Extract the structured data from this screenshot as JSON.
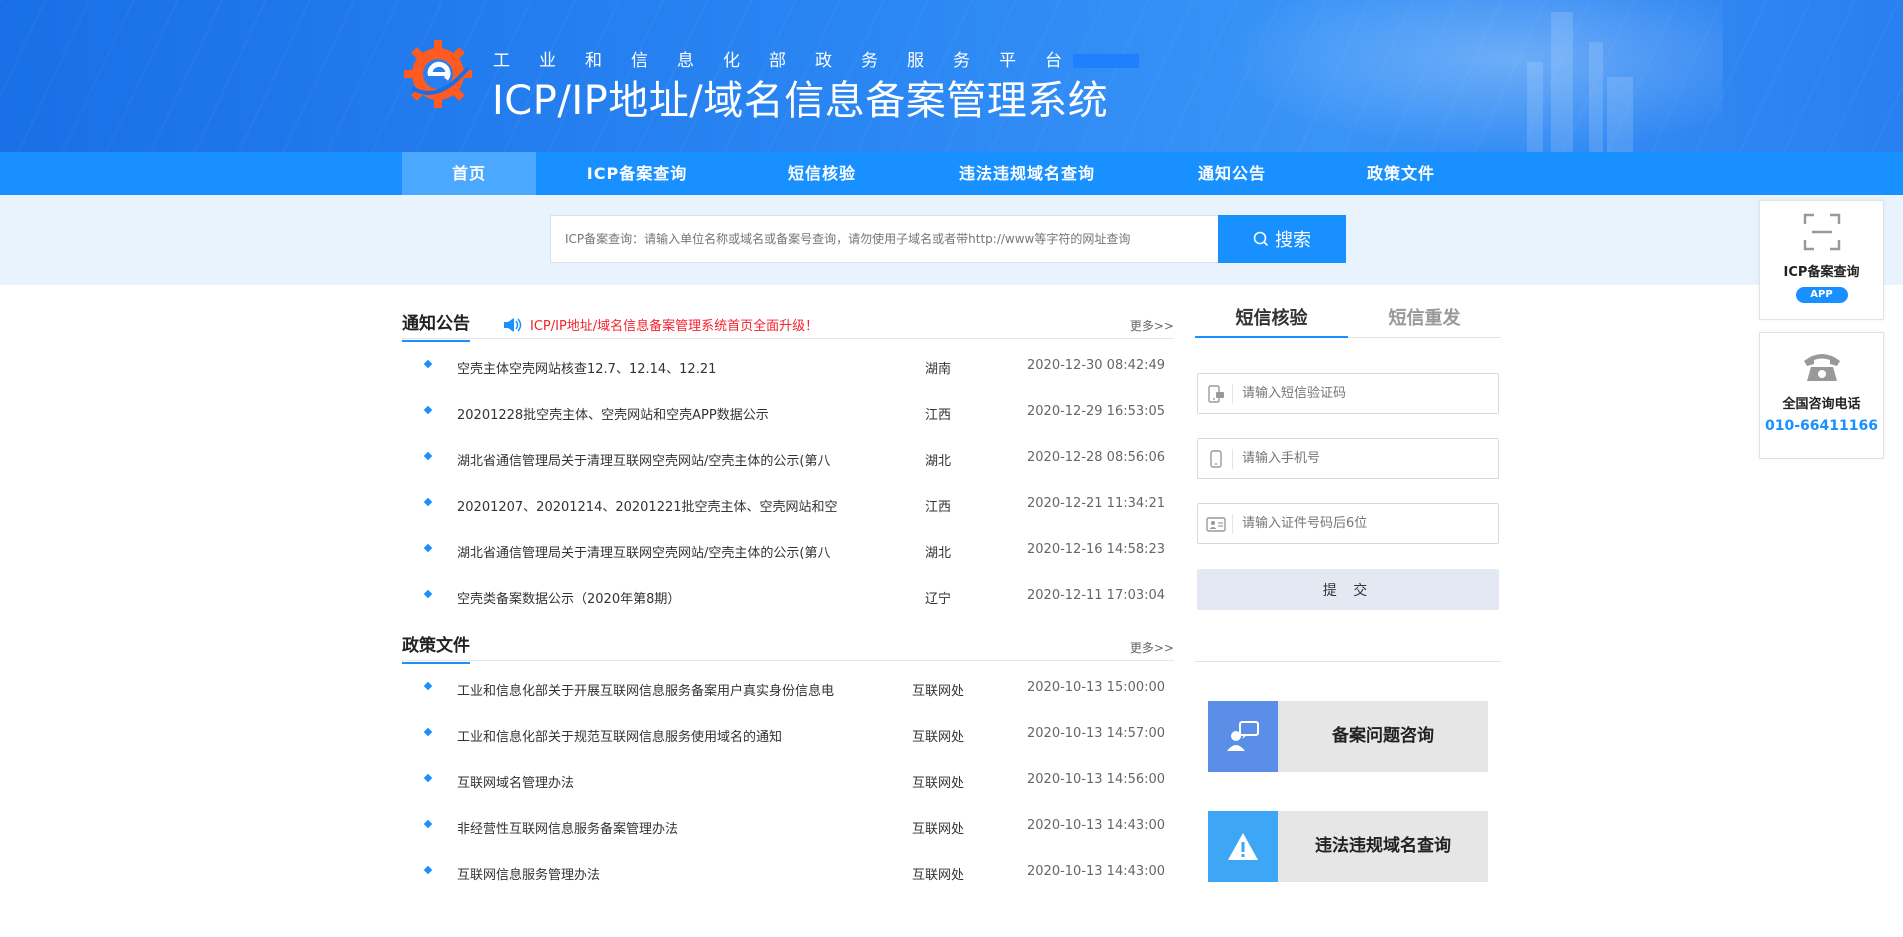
{
  "header": {
    "subtitle": "工业和信息化部政务服务平台",
    "title": "ICP/IP地址/域名信息备案管理系统"
  },
  "nav": {
    "items": [
      {
        "label": "首页",
        "active": true
      },
      {
        "label": "ICP备案查询"
      },
      {
        "label": "短信核验"
      },
      {
        "label": "违法违规域名查询"
      },
      {
        "label": "通知公告"
      },
      {
        "label": "政策文件"
      }
    ]
  },
  "search": {
    "placeholder": "ICP备案查询：请输入单位名称或域名或备案号查询，请勿使用子域名或者带http://www等字符的网址查询",
    "button_label": "搜索"
  },
  "notices": {
    "title": "通知公告",
    "alert": "ICP/IP地址/域名信息备案管理系统首页全面升级！",
    "more": "更多>>",
    "items": [
      {
        "title": "空壳主体空壳网站核查12.7、12.14、12.21",
        "region": "湖南",
        "date": "2020-12-30 08:42:49"
      },
      {
        "title": "20201228批空壳主体、空壳网站和空壳APP数据公示",
        "region": "江西",
        "date": "2020-12-29 16:53:05"
      },
      {
        "title": "湖北省通信管理局关于清理互联网空壳网站/空壳主体的公示(第八",
        "region": "湖北",
        "date": "2020-12-28 08:56:06"
      },
      {
        "title": "20201207、20201214、20201221批空壳主体、空壳网站和空",
        "region": "江西",
        "date": "2020-12-21 11:34:21"
      },
      {
        "title": "湖北省通信管理局关于清理互联网空壳网站/空壳主体的公示(第八",
        "region": "湖北",
        "date": "2020-12-16 14:58:23"
      },
      {
        "title": "空壳类备案数据公示（2020年第8期）",
        "region": "辽宁",
        "date": "2020-12-11 17:03:04"
      }
    ]
  },
  "policies": {
    "title": "政策文件",
    "more": "更多>>",
    "items": [
      {
        "title": "工业和信息化部关于开展互联网信息服务备案用户真实身份信息电",
        "region": "互联网处",
        "date": "2020-10-13 15:00:00"
      },
      {
        "title": "工业和信息化部关于规范互联网信息服务使用域名的通知",
        "region": "互联网处",
        "date": "2020-10-13 14:57:00"
      },
      {
        "title": "互联网域名管理办法",
        "region": "互联网处",
        "date": "2020-10-13 14:56:00"
      },
      {
        "title": "非经营性互联网信息服务备案管理办法",
        "region": "互联网处",
        "date": "2020-10-13 14:43:00"
      },
      {
        "title": "互联网信息服务管理办法",
        "region": "互联网处",
        "date": "2020-10-13 14:43:00"
      }
    ]
  },
  "sms": {
    "tab_verify": "短信核验",
    "tab_resend": "短信重发",
    "code_placeholder": "请输入短信验证码",
    "phone_placeholder": "请输入手机号",
    "id_placeholder": "请输入证件号码后6位",
    "submit_label": "提 交"
  },
  "quick_links": {
    "consult": "备案问题咨询",
    "illegal": "违法违规域名查询"
  },
  "float": {
    "app_label": "ICP备案查询",
    "app_pill": "APP",
    "phone_label": "全国咨询电话",
    "phone_number": "010-66411166"
  },
  "colors": {
    "primary": "#1890ff",
    "alert": "#f5222d",
    "consult_icon_bg": "#5b8ee6",
    "illegal_icon_bg": "#3ea7f5"
  }
}
